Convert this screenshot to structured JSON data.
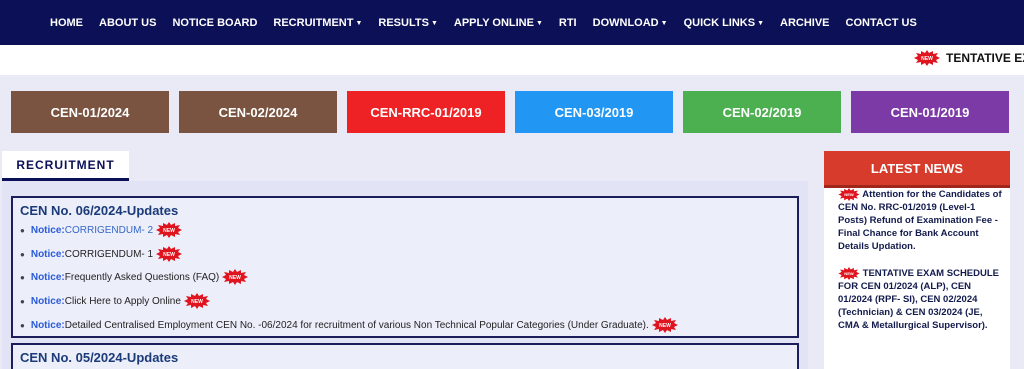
{
  "nav": [
    {
      "label": "HOME",
      "caret": false
    },
    {
      "label": "ABOUT US",
      "caret": false
    },
    {
      "label": "NOTICE BOARD",
      "caret": false
    },
    {
      "label": "RECRUITMENT",
      "caret": true
    },
    {
      "label": "RESULTS",
      "caret": true
    },
    {
      "label": "APPLY ONLINE",
      "caret": true
    },
    {
      "label": "RTI",
      "caret": false
    },
    {
      "label": "DOWNLOAD",
      "caret": true
    },
    {
      "label": "QUICK LINKS",
      "caret": true
    },
    {
      "label": "ARCHIVE",
      "caret": false
    },
    {
      "label": "CONTACT US",
      "caret": false
    }
  ],
  "ticker": {
    "text": "TENTATIVE EX"
  },
  "cen_buttons": [
    {
      "label": "CEN-01/2024",
      "color": "#7a5441"
    },
    {
      "label": "CEN-02/2024",
      "color": "#7a5441"
    },
    {
      "label": "CEN-RRC-01/2019",
      "color": "#ee2225"
    },
    {
      "label": "CEN-03/2019",
      "color": "#2196f3"
    },
    {
      "label": "CEN-02/2019",
      "color": "#4caf50"
    },
    {
      "label": "CEN-01/2019",
      "color": "#7b3aa6"
    }
  ],
  "recruitment": {
    "tab_label": "RECRUITMENT",
    "box1": {
      "title": "CEN No. 06/2024-Updates",
      "items": [
        {
          "label": "Notice:",
          "text": "CORRIGENDUM- 2",
          "link": true
        },
        {
          "label": "Notice:",
          "text": "CORRIGENDUM- 1",
          "link": false
        },
        {
          "label": "Notice:",
          "text": "Frequently Asked Questions (FAQ)",
          "link": false
        },
        {
          "label": "Notice:",
          "text": "Click Here to Apply Online",
          "link": false
        },
        {
          "label": "Notice:",
          "text": "Detailed Centralised Employment CEN No. -06/2024 for recruitment of various Non Technical Popular Categories (Under Graduate).",
          "link": false
        }
      ]
    },
    "box2": {
      "title": "CEN No. 05/2024-Updates"
    }
  },
  "latest_news": {
    "heading": "LATEST NEWS",
    "item1_head": "Attention for the Candidates",
    "item1_body": "of CEN No. RRC-01/2019 (Level-1 Posts) Refund of Examination Fee - Final Chance for Bank Account Details Updation.",
    "item2_head": "TENTATIVE EXAM",
    "item2_body": "SCHEDULE FOR CEN 01/2024 (ALP), CEN 01/2024 (RPF- SI), CEN 02/2024 (Technician) & CEN 03/2024 (JE, CMA & Metallurgical Supervisor)."
  },
  "icons": {
    "new_badge": "new-badge-icon"
  },
  "colors": {
    "nav_bg": "#0c1157",
    "news_head": "#d63b2c",
    "badge": "#e0141e"
  }
}
